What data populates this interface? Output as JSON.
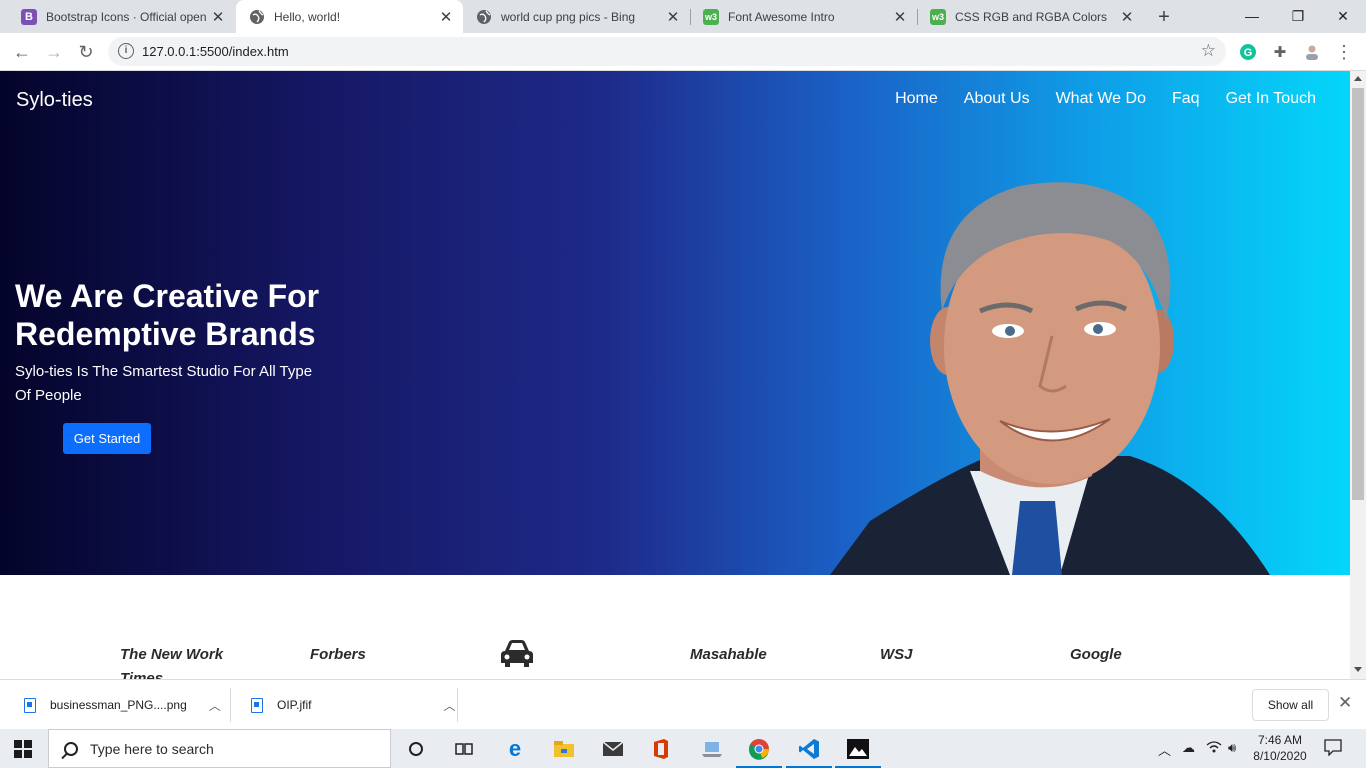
{
  "browser": {
    "tabs": [
      {
        "title": "Bootstrap Icons · Official open",
        "favicon": "bootstrap-icon",
        "favicon_text": "B",
        "favicon_color": "#7952b3",
        "active": false
      },
      {
        "title": "Hello, world!",
        "favicon": "globe-icon",
        "active": true
      },
      {
        "title": "world cup png pics - Bing",
        "favicon": "globe-icon",
        "active": false
      },
      {
        "title": "Font Awesome Intro",
        "favicon": "w3schools-icon",
        "favicon_text": "w3",
        "favicon_color": "#4caf50",
        "active": false
      },
      {
        "title": "CSS RGB and RGBA Colors",
        "favicon": "w3schools-icon",
        "favicon_text": "w3",
        "favicon_color": "#4caf50",
        "active": false
      }
    ],
    "url": "127.0.0.1:5500/index.htm"
  },
  "page": {
    "brand": "Sylo-ties",
    "nav": [
      "Home",
      "About Us",
      "What We Do",
      "Faq",
      "Get In Touch"
    ],
    "hero": {
      "title": "We Are Creative For Redemptive Brands",
      "subtitle": "Sylo-ties Is The Smartest Studio For All Type Of People",
      "cta": "Get Started"
    },
    "logos": {
      "l1": "The New Work Times",
      "l2": "Forbers",
      "icon": "car-icon",
      "l4": "Masahable",
      "l5": "WSJ",
      "l6": "Google"
    }
  },
  "downloads": {
    "items": [
      {
        "name": "businessman_PNG....png"
      },
      {
        "name": "OIP.jfif"
      }
    ],
    "show_all": "Show all"
  },
  "taskbar": {
    "search_placeholder": "Type here to search",
    "time": "7:46 AM",
    "date": "8/10/2020"
  },
  "colors": {
    "hero_start": "#04042a",
    "hero_end": "#04d6fa",
    "cta": "#0d6efd"
  }
}
